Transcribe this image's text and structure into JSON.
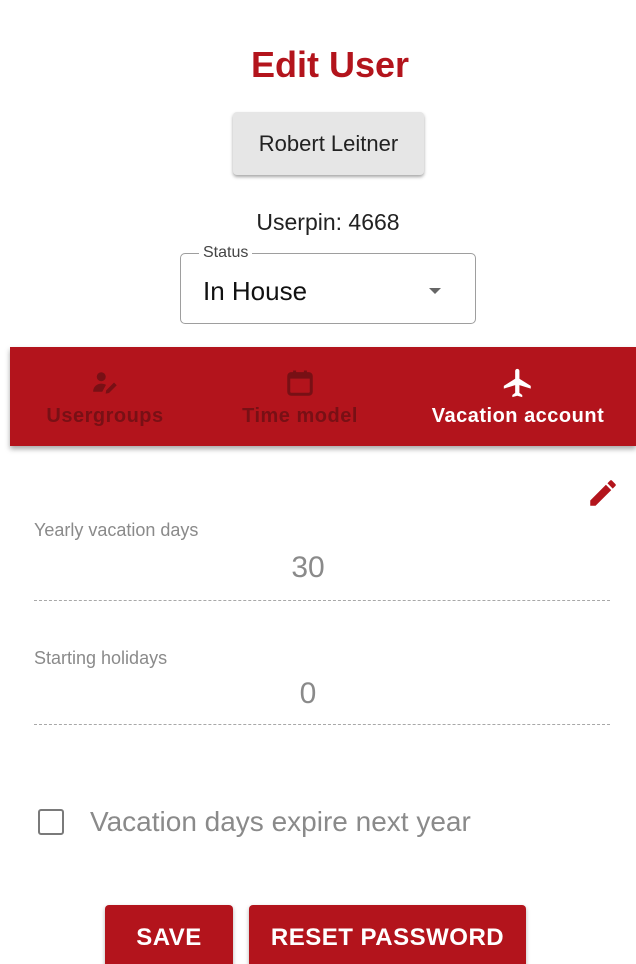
{
  "header": {
    "title": "Edit User",
    "user_name": "Robert Leitner",
    "userpin": "Userpin: 4668"
  },
  "status": {
    "legend": "Status",
    "value": "In House"
  },
  "tabs": [
    {
      "label": "Usergroups",
      "icon": "user-edit-icon",
      "active": false
    },
    {
      "label": "Time model",
      "icon": "calendar-icon",
      "active": false
    },
    {
      "label": "Vacation account",
      "icon": "airplane-icon",
      "active": true
    }
  ],
  "vacation": {
    "edit_icon": "pencil-icon",
    "yearly_label": "Yearly vacation days",
    "yearly_value": "30",
    "starting_label": "Starting holidays",
    "starting_value": "0",
    "expire_label": "Vacation days expire next year",
    "expire_checked": false
  },
  "actions": {
    "save_label": "SAVE",
    "reset_label": "RESET PASSWORD"
  },
  "colors": {
    "accent": "#b3141c",
    "inactive_tab_text": "#781015",
    "muted_text": "#8a8a8a"
  }
}
